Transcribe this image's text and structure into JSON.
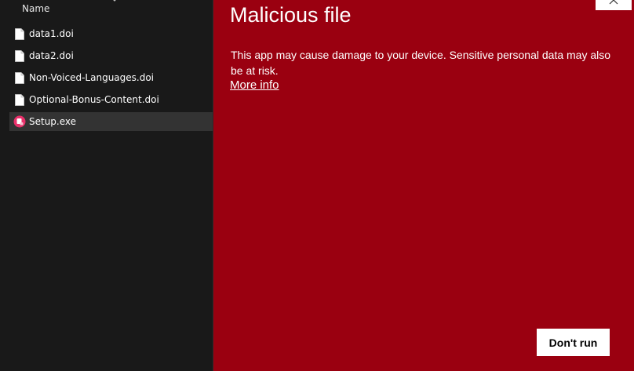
{
  "explorer": {
    "column_header": "Name",
    "files": [
      {
        "name": "data1.doi",
        "icon": "document-icon",
        "selected": false
      },
      {
        "name": "data2.doi",
        "icon": "document-icon",
        "selected": false
      },
      {
        "name": "Non-Voiced-Languages.doi",
        "icon": "document-icon",
        "selected": false
      },
      {
        "name": "Optional-Bonus-Content.doi",
        "icon": "document-icon",
        "selected": false
      },
      {
        "name": "Setup.exe",
        "icon": "installer-icon",
        "selected": true
      }
    ]
  },
  "smartscreen": {
    "title": "Malicious file",
    "message": "This app may cause damage to your device. Sensitive personal data may also be at risk.",
    "more_info": "More info",
    "dont_run_label": "Don't run",
    "close_icon": "close-icon"
  },
  "colors": {
    "explorer_bg": "#191919",
    "selection_bg": "#333333",
    "warning_bg": "#9a0010",
    "button_bg": "#ffffff",
    "installer_icon_pink": "#e8306a"
  }
}
